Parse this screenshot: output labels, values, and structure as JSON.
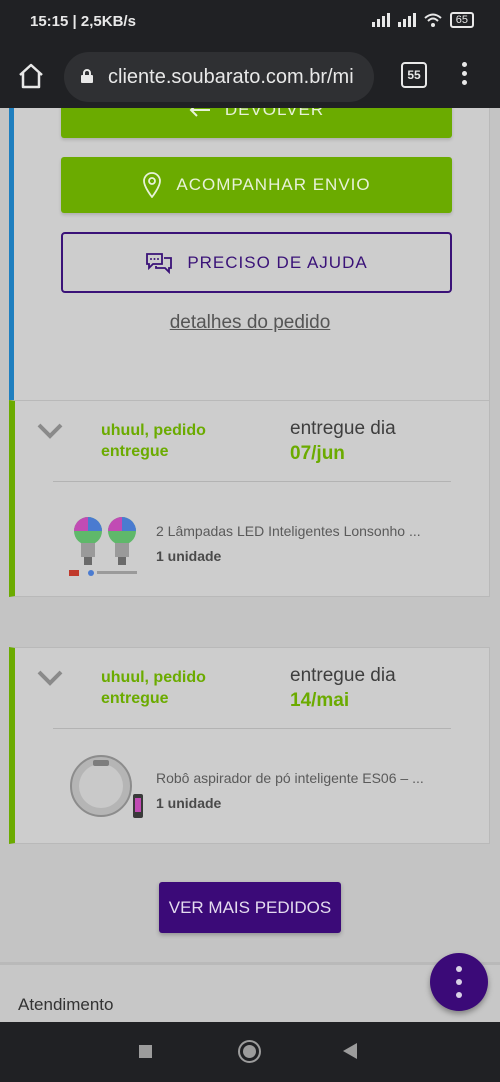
{
  "status_bar": {
    "time": "15:15 | 2,5KB/s",
    "battery": "65"
  },
  "browser": {
    "url": "cliente.soubarato.com.br/mi",
    "tab_count": "55"
  },
  "actions": {
    "return_label": "DEVOLVER",
    "track_label": "ACOMPANHAR ENVIO",
    "help_label": "PRECISO DE AJUDA",
    "details_label": "detalhes do pedido"
  },
  "orders": [
    {
      "status": "uhuul, pedido entregue",
      "delivered_label": "entregue dia",
      "delivered_date": "07/jun",
      "product_name": "2 Lâmpadas LED Inteligentes Lonsonho ...",
      "quantity": "1 unidade"
    },
    {
      "status": "uhuul, pedido entregue",
      "delivered_label": "entregue dia",
      "delivered_date": "14/mai",
      "product_name": "Robô aspirador de pó inteligente ES06 – ...",
      "quantity": "1 unidade"
    }
  ],
  "more_orders_label": "VER MAIS PEDIDOS",
  "footer": {
    "support_label": "Atendimento"
  },
  "colors": {
    "green": "#6bab00",
    "purple": "#3b0a78",
    "blue_accent": "#1f7fbf"
  }
}
